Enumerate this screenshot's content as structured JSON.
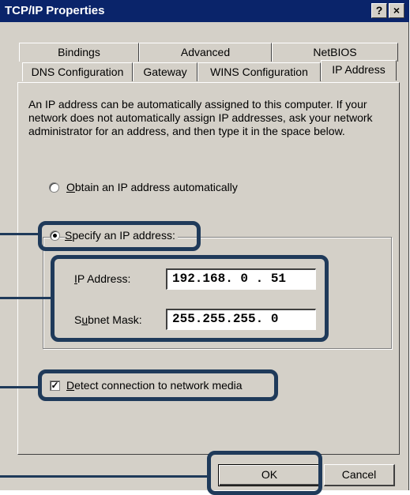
{
  "window": {
    "title": "TCP/IP Properties",
    "help_button": "?",
    "close_button": "×"
  },
  "tabs": {
    "back_row": [
      {
        "label": "Bindings"
      },
      {
        "label": "Advanced"
      },
      {
        "label": "NetBIOS"
      }
    ],
    "front_row": [
      {
        "label": "DNS Configuration"
      },
      {
        "label": "Gateway"
      },
      {
        "label": "WINS Configuration"
      },
      {
        "label": "IP Address",
        "active": true
      }
    ]
  },
  "description": "An IP address can be automatically assigned to this computer. If your network does not automatically assign IP addresses, ask your network administrator for an address, and then type it in the space below.",
  "options": {
    "obtain_auto": {
      "label_first": "O",
      "label_rest": "btain an IP address automatically",
      "selected": false
    },
    "specify": {
      "label_first": "S",
      "label_rest": "pecify an IP address:",
      "selected": true
    }
  },
  "fields": {
    "ip_address": {
      "label_first": "I",
      "label_rest": "P Address:",
      "value": "192.168. 0 . 51"
    },
    "subnet_mask": {
      "label_pre": "S",
      "label_u": "u",
      "label_rest": "bnet Mask:",
      "value": "255.255.255. 0"
    }
  },
  "detect_media": {
    "checked": true,
    "mark": "✓",
    "label_first": "D",
    "label_rest": "etect connection to network media"
  },
  "buttons": {
    "ok": "OK",
    "cancel": "Cancel"
  },
  "colors": {
    "titlebar": "#0a246a",
    "face": "#d4d0c8",
    "callout": "#1f3a5a"
  }
}
